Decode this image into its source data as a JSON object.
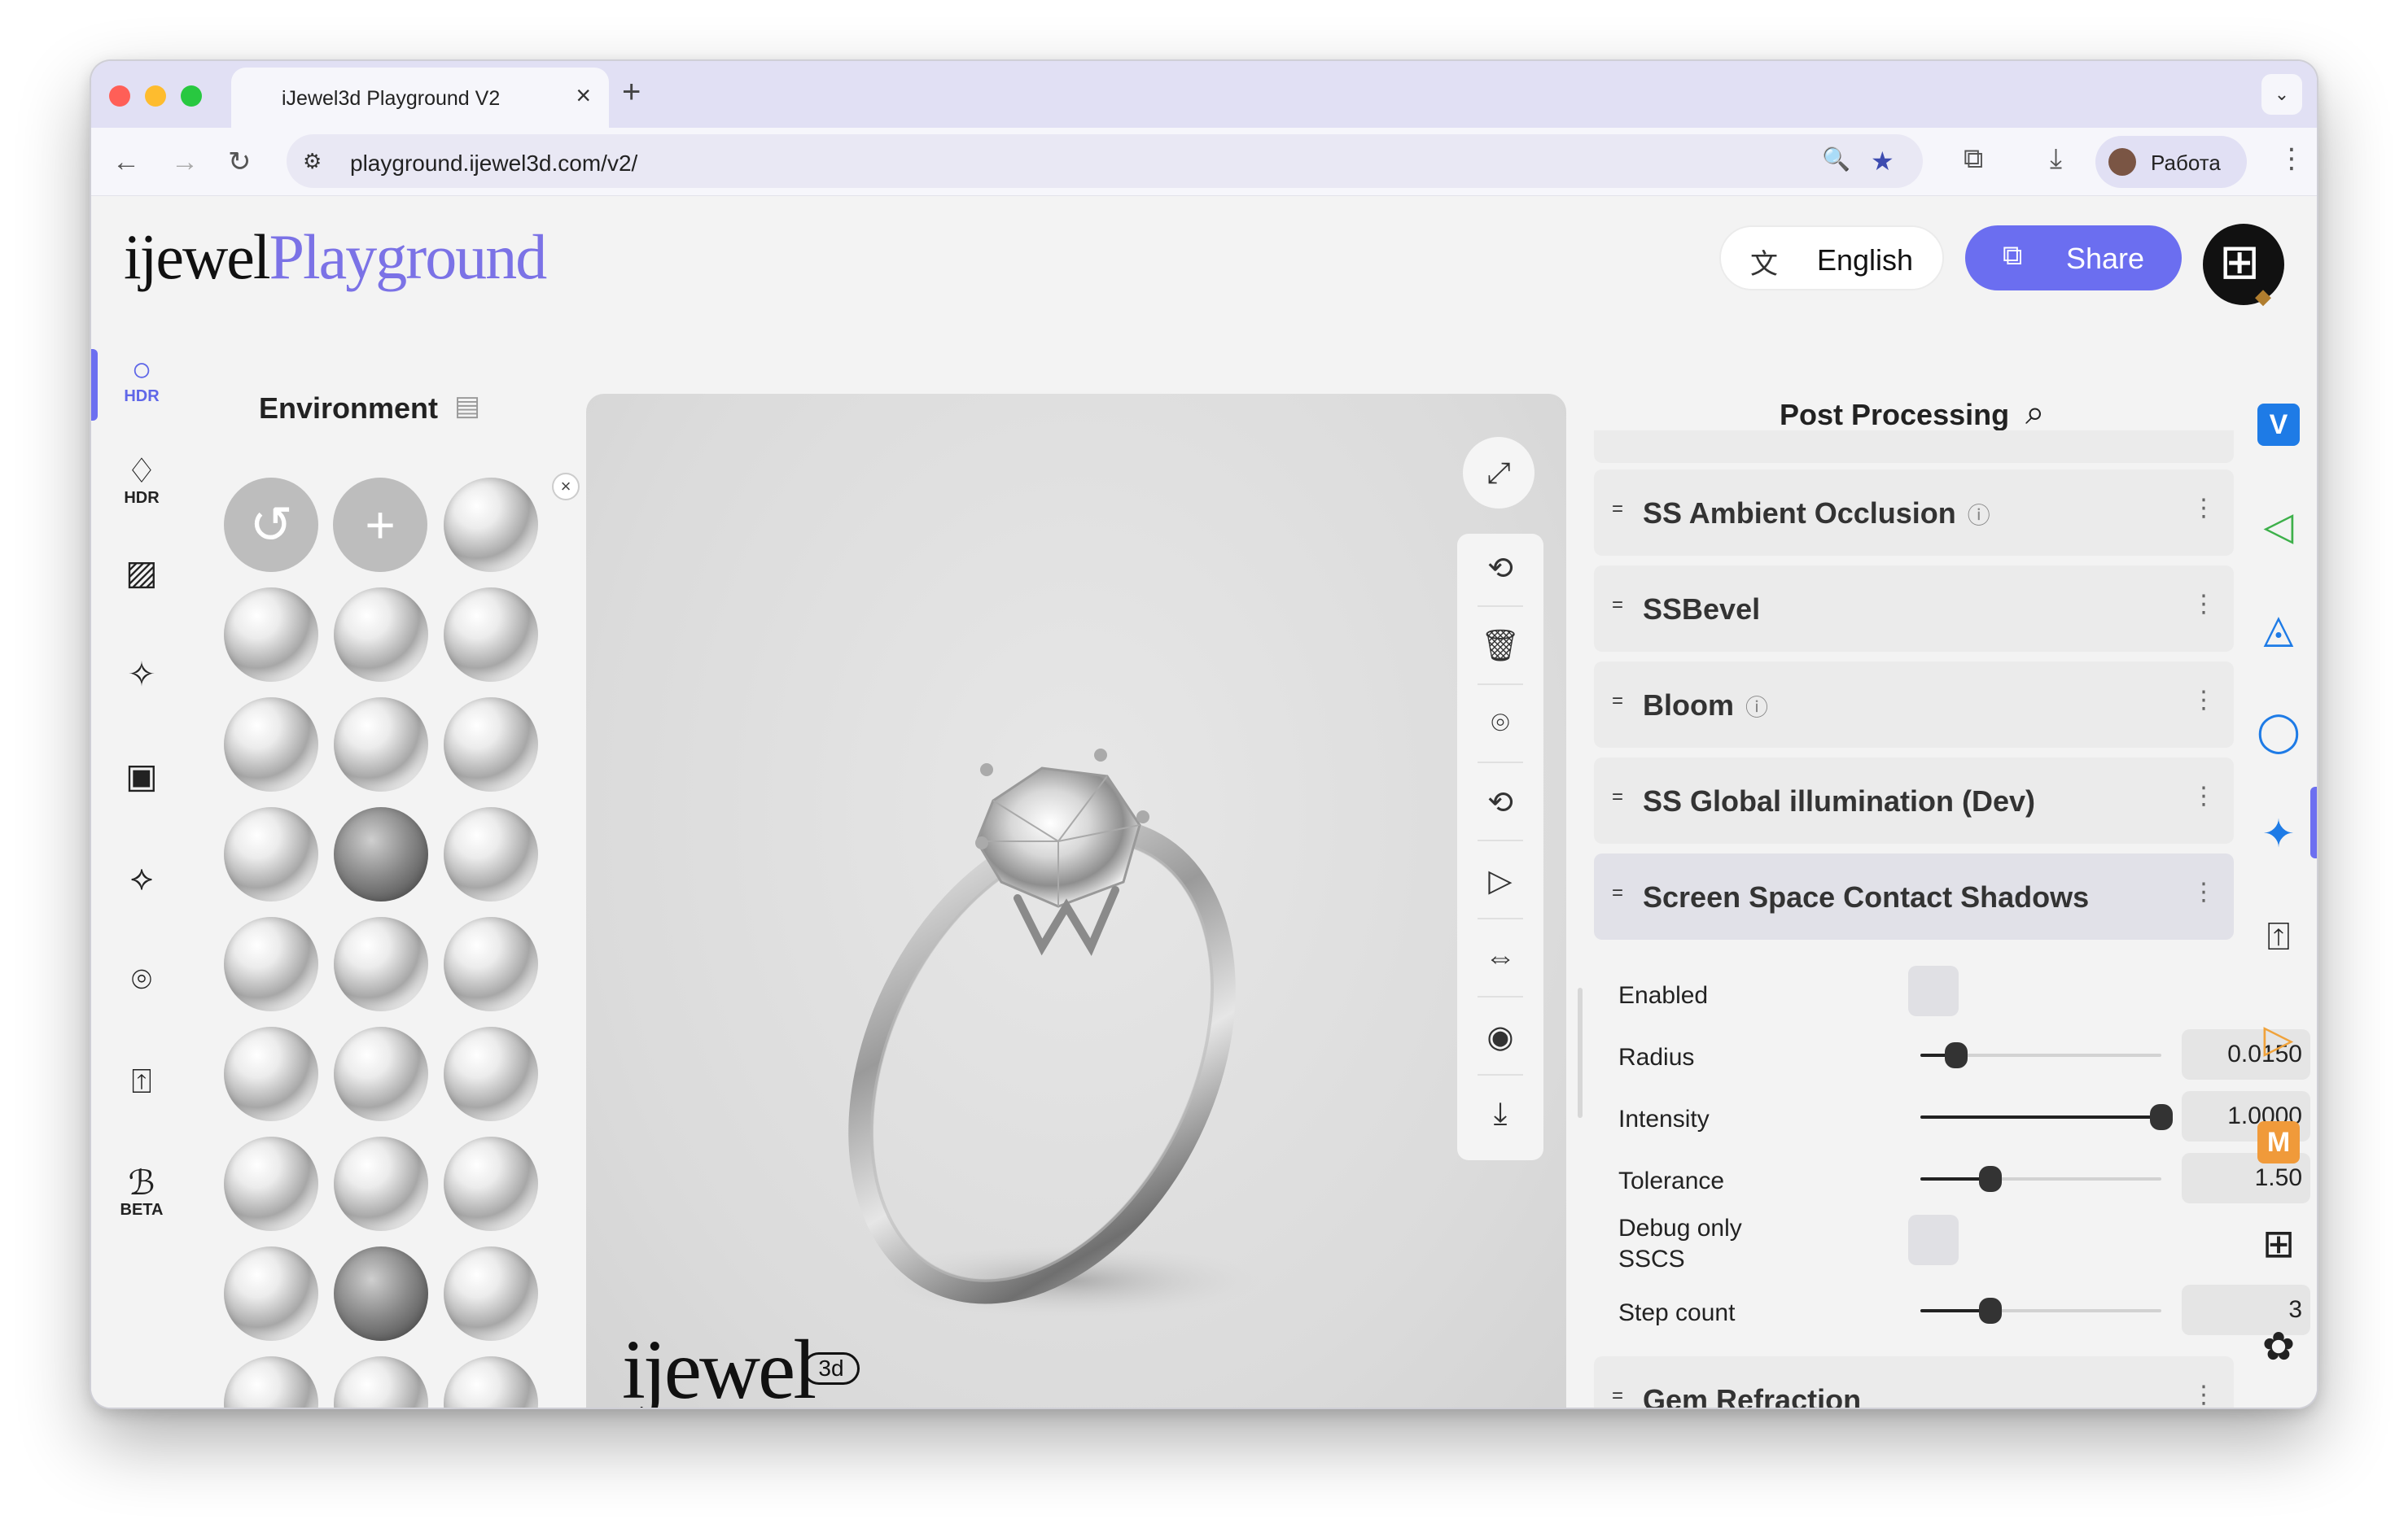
{
  "browser": {
    "tab_title": "iJewel3d Playground V2",
    "tab_close_icon": "×",
    "new_tab_icon": "+",
    "tab_menu_icon": "⌄",
    "url": "playground.ijewel3d.com/v2/",
    "profile_name": "Работа",
    "nav": {
      "back": "←",
      "forward": "→",
      "reload": "↻",
      "site_info": "⚙"
    },
    "icons": {
      "zoom": "🔍",
      "star": "★",
      "extensions": "⧉",
      "downloads": "⤓",
      "menu": "⋮"
    }
  },
  "header": {
    "logo_left": "ijewel",
    "logo_right": "Playground",
    "language_icon": "文",
    "language": "English",
    "share_icon": "⧉",
    "share_label": "Share",
    "qr_icon": "⊞",
    "gem_icon": "◆"
  },
  "left_sidebar": {
    "items": [
      {
        "icon": "○",
        "sub": "HDR",
        "active": true,
        "name": "hdr-environment"
      },
      {
        "icon": "♢",
        "sub": "HDR",
        "active": false,
        "name": "hdr-gem"
      },
      {
        "icon": "▨",
        "sub": "",
        "active": false,
        "name": "background"
      },
      {
        "icon": "✧",
        "sub": "",
        "active": false,
        "name": "sparkle"
      },
      {
        "icon": "▣",
        "sub": "",
        "active": false,
        "name": "scene"
      },
      {
        "icon": "⟡",
        "sub": "",
        "active": false,
        "name": "ground"
      },
      {
        "icon": "⌾",
        "sub": "",
        "active": false,
        "name": "ring"
      },
      {
        "icon": "⍐",
        "sub": "",
        "active": false,
        "name": "upload"
      },
      {
        "icon": "ℬ",
        "sub": "BETA",
        "active": false,
        "name": "beta"
      }
    ],
    "collapse_icon": "«"
  },
  "environment": {
    "title": "Environment",
    "book_icon": "▤",
    "reset_icon": "↺",
    "add_icon": "+",
    "remove_icon": "×"
  },
  "viewer": {
    "fullscreen_icon": "⤢",
    "tools": [
      "⟲",
      "🗑",
      "⌾",
      "⟲",
      "▷",
      "⇔",
      "◉",
      "⤓"
    ],
    "watermark": "ijewel",
    "watermark_badge": "3d"
  },
  "post_processing": {
    "title": "Post Processing",
    "search_icon": "⌕",
    "drag_icon": "=",
    "more_icon": "⋮",
    "info_icon": "ⓘ",
    "sections": [
      {
        "title": "SS Ambient Occlusion",
        "info": true,
        "active": false
      },
      {
        "title": "SSBevel",
        "info": false,
        "active": false
      },
      {
        "title": "Bloom",
        "info": true,
        "active": false
      },
      {
        "title": "SS Global illumination (Dev)",
        "info": false,
        "active": false
      },
      {
        "title": "Screen Space Contact Shadows",
        "info": false,
        "active": true
      }
    ],
    "contact_shadows": {
      "enabled_label": "Enabled",
      "enabled": false,
      "radius_label": "Radius",
      "radius_value": "0.0150",
      "radius_fill": 0.15,
      "intensity_label": "Intensity",
      "intensity_value": "1.0000",
      "intensity_fill": 1.0,
      "tolerance_label": "Tolerance",
      "tolerance_value": "1.50",
      "tolerance_fill": 0.29,
      "debug_label": "Debug only SSCS",
      "debug": false,
      "step_label": "Step count",
      "step_value": "3",
      "step_fill": 0.29
    },
    "last_section": "Gem Refraction"
  },
  "right_sidebar": {
    "items": [
      {
        "icon": "V",
        "name": "v-plugin",
        "color": "#1e7be6"
      },
      {
        "icon": "◁",
        "name": "pointer-tool",
        "color": "#3db04a"
      },
      {
        "icon": "◬",
        "name": "materials",
        "color": "#1e7be6"
      },
      {
        "icon": "◯",
        "name": "rotate",
        "color": "#1e7be6"
      },
      {
        "icon": "✦",
        "name": "sparkle",
        "color": "#1e7be6"
      },
      {
        "icon": "⍐",
        "name": "upload",
        "color": "#222222"
      },
      {
        "icon": "▷",
        "name": "animation",
        "color": "#f0a23a"
      },
      {
        "icon": "M",
        "name": "m-plugin",
        "color": "#f09a3a"
      },
      {
        "icon": "⊞",
        "name": "grid",
        "color": "#222222"
      },
      {
        "icon": "✿",
        "name": "plugins",
        "color": "#222222"
      }
    ]
  }
}
